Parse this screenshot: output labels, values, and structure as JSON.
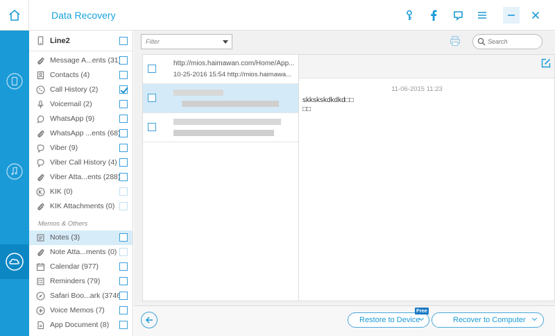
{
  "header": {
    "title": "Data Recovery"
  },
  "device": {
    "name": "Line2"
  },
  "categories": [
    {
      "label": "Message A...ents (31)",
      "checked": false,
      "disabled": false
    },
    {
      "label": "Contacts (4)",
      "checked": false,
      "disabled": false
    },
    {
      "label": "Call History (2)",
      "checked": true,
      "disabled": false
    },
    {
      "label": "Voicemail (2)",
      "checked": false,
      "disabled": false
    },
    {
      "label": "WhatsApp (9)",
      "checked": false,
      "disabled": false
    },
    {
      "label": "WhatsApp ...ents (68)",
      "checked": false,
      "disabled": false
    },
    {
      "label": "Viber (9)",
      "checked": false,
      "disabled": false
    },
    {
      "label": "Viber Call History (4)",
      "checked": false,
      "disabled": false
    },
    {
      "label": "Viber Atta...ents (288)",
      "checked": false,
      "disabled": false
    },
    {
      "label": "KIK (0)",
      "checked": false,
      "disabled": true
    },
    {
      "label": "KIK Attachments (0)",
      "checked": false,
      "disabled": true
    }
  ],
  "memos_section": {
    "title": "Memos & Others"
  },
  "memos": [
    {
      "label": "Notes (3)",
      "checked": false,
      "disabled": false
    },
    {
      "label": "Note Atta...ments (0)",
      "checked": false,
      "disabled": true
    },
    {
      "label": "Calendar (977)",
      "checked": false,
      "disabled": false
    },
    {
      "label": "Reminders (79)",
      "checked": false,
      "disabled": false
    },
    {
      "label": "Safari Boo...ark (3746)",
      "checked": false,
      "disabled": false
    },
    {
      "label": "Voice Memos (7)",
      "checked": false,
      "disabled": false
    },
    {
      "label": "App Document (8)",
      "checked": false,
      "disabled": false
    }
  ],
  "toolbar": {
    "filter_label": "Filter",
    "search_placeholder": "Search"
  },
  "list": {
    "first_item": {
      "title": "http://mios.haimawan.com/Home/App...",
      "subtitle": "10-25-2016 15:54  http://mios.haimawa..."
    }
  },
  "detail": {
    "date": "11-06-2015 11:23",
    "line1": "skkskskdkdkd□□",
    "line2": "□□"
  },
  "footer": {
    "restore_label": "Restore to Device",
    "free_badge": "Free",
    "recover_label": "Recover to Computer"
  },
  "colors": {
    "accent": "#1a9ad6",
    "rail": "#1a9ad6",
    "selected_row": "#d4eaf8"
  }
}
